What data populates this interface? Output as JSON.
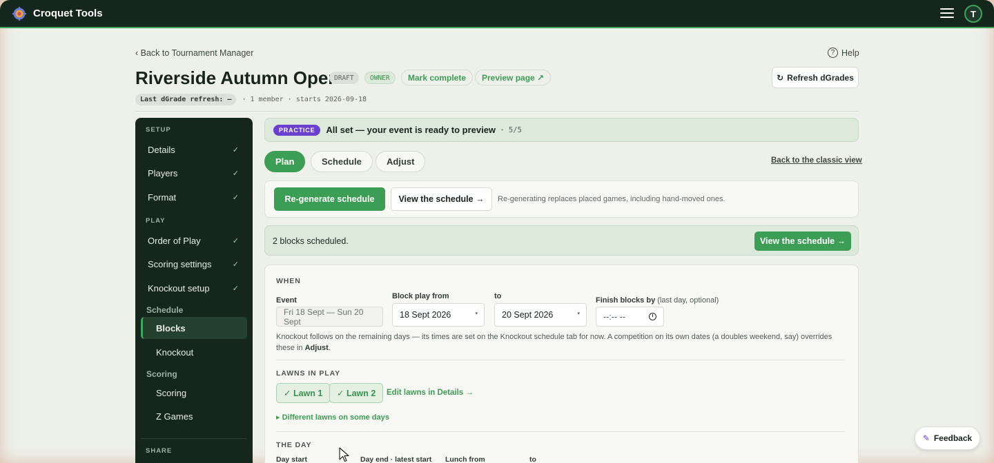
{
  "app": {
    "title": "Croquet Tools",
    "avatar_initial": "T",
    "accent_color": "#3c9e55",
    "dark_color": "#15271d"
  },
  "header": {
    "back_link": "‹ Back to Tournament Manager",
    "help": "Help",
    "help_icon": "?",
    "title": "Riverside Autumn Open",
    "badge_draft": "DRAFT",
    "badge_owner": "OWNER",
    "mark_complete": "Mark complete",
    "preview_page": "Preview page ↗",
    "refresh_button": "Refresh dGrades",
    "refresh_icon": "↻",
    "meta_chip": "Last dGrade refresh: —",
    "meta_text": "· 1 member · starts 2026-09-18"
  },
  "sidebar": {
    "setup_label": "SETUP",
    "play_label": "PLAY",
    "share_label": "SHARE",
    "check": "✓",
    "setup_items": [
      "Details",
      "Players",
      "Format"
    ],
    "play_items": [
      "Order of Play",
      "Scoring settings",
      "Knockout setup"
    ],
    "schedule_group": "Schedule",
    "schedule_items": [
      "Blocks",
      "Knockout"
    ],
    "scoring_group": "Scoring",
    "scoring_items": [
      "Scoring",
      "Z Games"
    ]
  },
  "status": {
    "tag": "PRACTICE",
    "text": "All set — your event is ready to preview",
    "dot": "•",
    "count": "5/5"
  },
  "tabs": {
    "plan": "Plan",
    "schedule": "Schedule",
    "adjust": "Adjust",
    "classic_link": "Back to the classic view"
  },
  "regen": {
    "button": "Re-generate schedule",
    "view_button": "View the schedule →",
    "note": "Re-generating replaces placed games, including hand-moved ones."
  },
  "blocks": {
    "text": "2 blocks scheduled.",
    "view_button": "View the schedule →"
  },
  "when": {
    "heading": "WHEN",
    "event_label": "Event",
    "event_value": "Fri 18 Sept — Sun 20 Sept",
    "from_label": "Block play from",
    "from_value": "18 Sept 2026",
    "to_label": "to",
    "to_value": "20 Sept 2026",
    "finish_label": "Finish blocks by",
    "finish_optional": "(last day, optional)",
    "finish_value": "--:-- --",
    "caret": "▾",
    "help_pre": "Knockout follows on the remaining days — its times are set on the Knockout schedule tab for now. A competition on its own dates (a doubles weekend, say) overrides these in ",
    "help_bold": "Adjust",
    "help_post": "."
  },
  "lawns": {
    "heading": "LAWNS IN PLAY",
    "lawn1": "✓ Lawn 1",
    "lawn2": "✓ Lawn 2",
    "edit_link": "Edit lawns in Details →",
    "different_link": "▸ Different lawns on some days"
  },
  "day": {
    "heading": "THE DAY",
    "cols": [
      "Day start",
      "Day end · latest start",
      "Lunch from",
      "to"
    ]
  },
  "feedback": {
    "label": "Feedback",
    "icon": "✎"
  }
}
